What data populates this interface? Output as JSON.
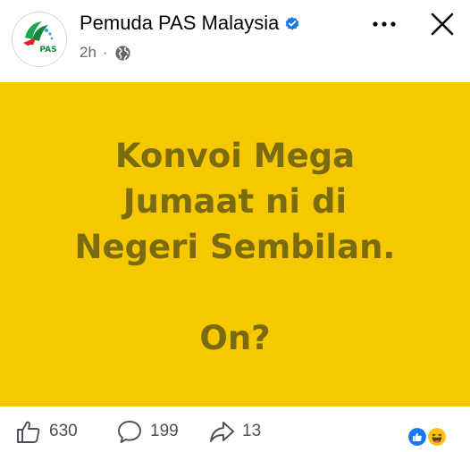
{
  "post": {
    "page_name": "Pemuda PAS Malaysia",
    "time": "2h",
    "separator": "·",
    "avatar_logo_text": "PAS",
    "body_lines": [
      "Konvoi Mega",
      "Jumaat ni di",
      "Negeri Sembilan.",
      "",
      "On?"
    ],
    "background_color": "#f5c800",
    "text_color": "#7a6a10"
  },
  "header_icons": {
    "verified": "verified-badge-icon",
    "globe": "globe-icon",
    "more": "more-options-icon",
    "close": "close-icon"
  },
  "engagement": {
    "likes": "630",
    "comments": "199",
    "shares": "13",
    "reaction_icons": [
      "like-reaction-icon",
      "haha-reaction-icon"
    ]
  },
  "colors": {
    "verified_blue": "#1877f2",
    "like_blue": "#1877f2",
    "haha_yellow": "#f7c21a"
  }
}
